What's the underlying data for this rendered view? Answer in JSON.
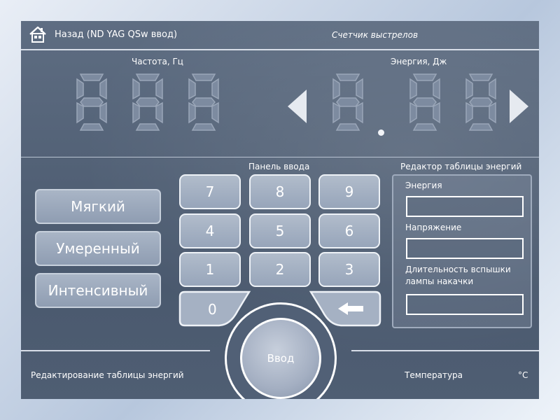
{
  "header": {
    "back_label": "Назад (ND YAG QSw ввод)",
    "counter_label": "Счетчик выстрелов"
  },
  "display": {
    "frequency_label": "Частота, Гц",
    "energy_label": "Энергия, Дж",
    "frequency_value": "",
    "energy_value": ""
  },
  "modes": {
    "soft": "Мягкий",
    "moderate": "Умеренный",
    "intense": "Интенсивный"
  },
  "keypad": {
    "title": "Панель ввода",
    "keys": [
      "7",
      "8",
      "9",
      "4",
      "5",
      "6",
      "1",
      "2",
      "3"
    ],
    "zero": "0",
    "enter": "Ввод"
  },
  "editor": {
    "title": "Редактор таблицы энергий",
    "energy_label": "Энергия",
    "energy_value": "",
    "voltage_label": "Напряжение",
    "voltage_value": "",
    "flash_label": "Длительность вспышки лампы накачки",
    "flash_value": ""
  },
  "footer": {
    "edit_table_label": "Редактирование таблицы энергий",
    "temperature_label": "Температура",
    "temperature_unit": "°C"
  },
  "icons": {
    "home": "home-icon",
    "left": "left-arrow-icon",
    "right": "right-arrow-icon",
    "backspace": "backspace-arrow-icon"
  }
}
